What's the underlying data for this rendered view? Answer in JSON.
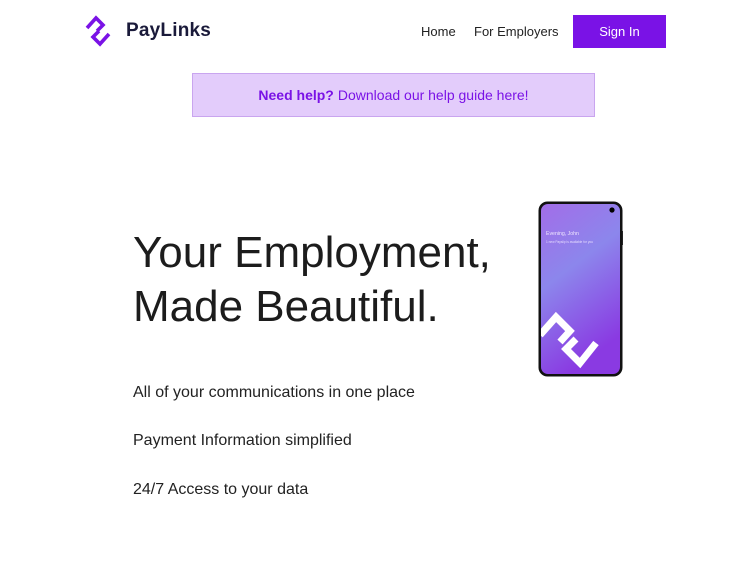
{
  "header": {
    "brand_name": "PayLinks",
    "logo_icon": "paylinks-logo-icon",
    "nav": {
      "home": "Home",
      "employers": "For Employers"
    },
    "sign_in_label": "Sign In"
  },
  "help_banner": {
    "strong": "Need help?",
    "text": "Download our help guide here!"
  },
  "hero": {
    "title_line1": "Your Employment,",
    "title_line2": "Made Beautiful.",
    "features": [
      "All of your communications in one place",
      "Payment Information simplified",
      "24/7 Access to your data"
    ]
  },
  "phone": {
    "greeting": "Evening, John",
    "subtext": "1 new Payslip is available for you"
  },
  "colors": {
    "accent": "#7a12e6",
    "banner_bg": "#e3ccfb",
    "banner_border": "#c9a5ef",
    "brand_text": "#1a1a3a"
  }
}
